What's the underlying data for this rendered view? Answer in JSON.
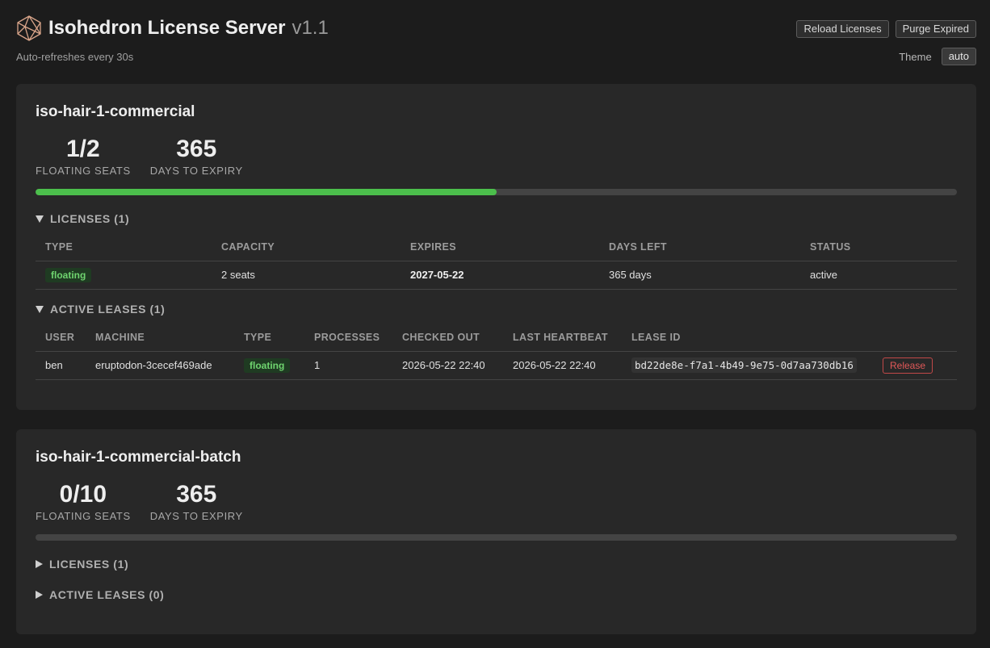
{
  "header": {
    "title": "Isohedron License Server",
    "version": "v1.1",
    "subtitle": "Auto-refreshes every 30s",
    "reload_label": "Reload Licenses",
    "purge_label": "Purge Expired",
    "theme_label": "Theme",
    "theme_value": "auto"
  },
  "pools": [
    {
      "name": "iso-hair-1-commercial",
      "seats": "1/2",
      "seats_label": "FLOATING SEATS",
      "days": "365",
      "days_label": "DAYS TO EXPIRY",
      "usage_fraction": 0.5,
      "licenses_header": "LICENSES (1)",
      "licenses_expanded": true,
      "license_columns": [
        "TYPE",
        "CAPACITY",
        "EXPIRES",
        "DAYS LEFT",
        "STATUS"
      ],
      "licenses": [
        {
          "type": "floating",
          "capacity": "2 seats",
          "expires": "2027-05-22",
          "days_left": "365 days",
          "status": "active"
        }
      ],
      "leases_header": "ACTIVE LEASES (1)",
      "leases_expanded": true,
      "lease_columns": [
        "USER",
        "MACHINE",
        "TYPE",
        "PROCESSES",
        "CHECKED OUT",
        "LAST HEARTBEAT",
        "LEASE ID",
        ""
      ],
      "leases": [
        {
          "user": "ben",
          "machine": "eruptodon-3cecef469ade",
          "type": "floating",
          "processes": "1",
          "checked_out": "2026-05-22 22:40",
          "last_heartbeat": "2026-05-22 22:40",
          "lease_id": "bd22de8e-f7a1-4b49-9e75-0d7aa730db16",
          "action": "Release"
        }
      ]
    },
    {
      "name": "iso-hair-1-commercial-batch",
      "seats": "0/10",
      "seats_label": "FLOATING SEATS",
      "days": "365",
      "days_label": "DAYS TO EXPIRY",
      "usage_fraction": 0.0,
      "licenses_header": "LICENSES (1)",
      "licenses_expanded": false,
      "leases_header": "ACTIVE LEASES (0)",
      "leases_expanded": false
    }
  ],
  "colors": {
    "background": "#1c1c1c",
    "card": "#282828",
    "progress_fill": "#4cbf4c",
    "badge_text": "#6fd46f",
    "release": "#e05858"
  },
  "icons": {
    "logo": "icosahedron-logo-icon",
    "expanded": "triangle-down-icon",
    "collapsed": "triangle-right-icon"
  }
}
